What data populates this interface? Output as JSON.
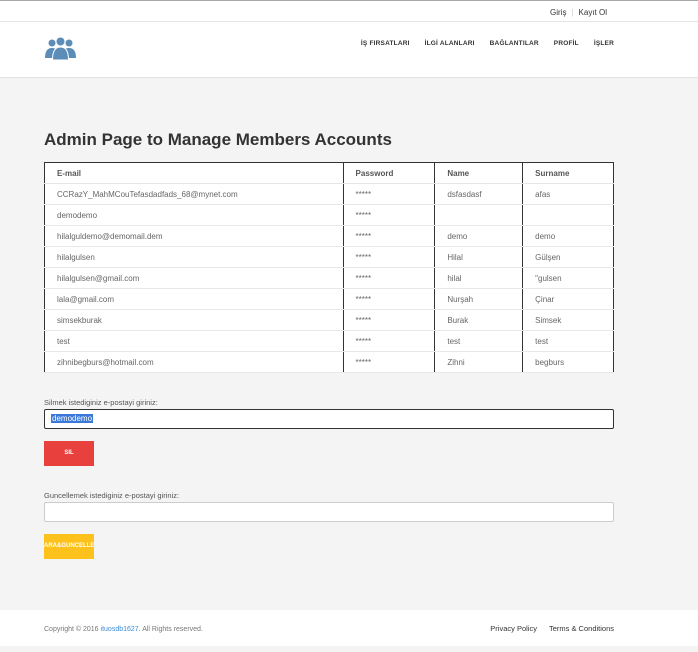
{
  "topbar": {
    "login": "Giriş",
    "register": "Kayıt Ol"
  },
  "nav": [
    "İŞ FIRSATLARI",
    "İLGİ ALANLARI",
    "BAĞLANTILAR",
    "PROFİL",
    "İŞLER"
  ],
  "page_title": "Admin Page to Manage Members Accounts",
  "table": {
    "headers": [
      "E-mail",
      "Password",
      "Name",
      "Surname"
    ],
    "rows": [
      [
        "CCRazY_MahMCouTefasdadfads_68@mynet.com",
        "*****",
        "dsfasdasf",
        "afas"
      ],
      [
        "demodemo",
        "*****",
        "",
        ""
      ],
      [
        "hilalguldemo@demomail.dem",
        "*****",
        "demo",
        "demo"
      ],
      [
        "hilalgulsen",
        "*****",
        "Hilal",
        "Gülşen"
      ],
      [
        "hilalgulsen@gmail.com",
        "*****",
        "hilal",
        "\"gulsen"
      ],
      [
        "lala@gmail.com",
        "*****",
        "Nurşah",
        "Çinar"
      ],
      [
        "simsekburak",
        "*****",
        "Burak",
        "Simsek"
      ],
      [
        "test",
        "*****",
        "test",
        "test"
      ],
      [
        "zihnibegburs@hotmail.com",
        "*****",
        "Zihni",
        "begburs"
      ]
    ]
  },
  "delete_form": {
    "label": "Silmek istediginiz e-postayi giriniz:",
    "value": "demodemo",
    "button": "SIL"
  },
  "update_form": {
    "label": "Guncellemek istediginiz e-postayi giriniz:",
    "value": "",
    "button": "ARA&GUNCELLE"
  },
  "footer": {
    "copy_prefix": "Copyright © 2016 ",
    "copy_link": "ituosdb1627",
    "copy_suffix": ". All Rights reserved.",
    "privacy": "Privacy Policy",
    "terms": "Terms & Conditions"
  },
  "colors": {
    "danger": "#e8403c",
    "warning": "#fcc21b",
    "logo": "#5b8db8"
  }
}
